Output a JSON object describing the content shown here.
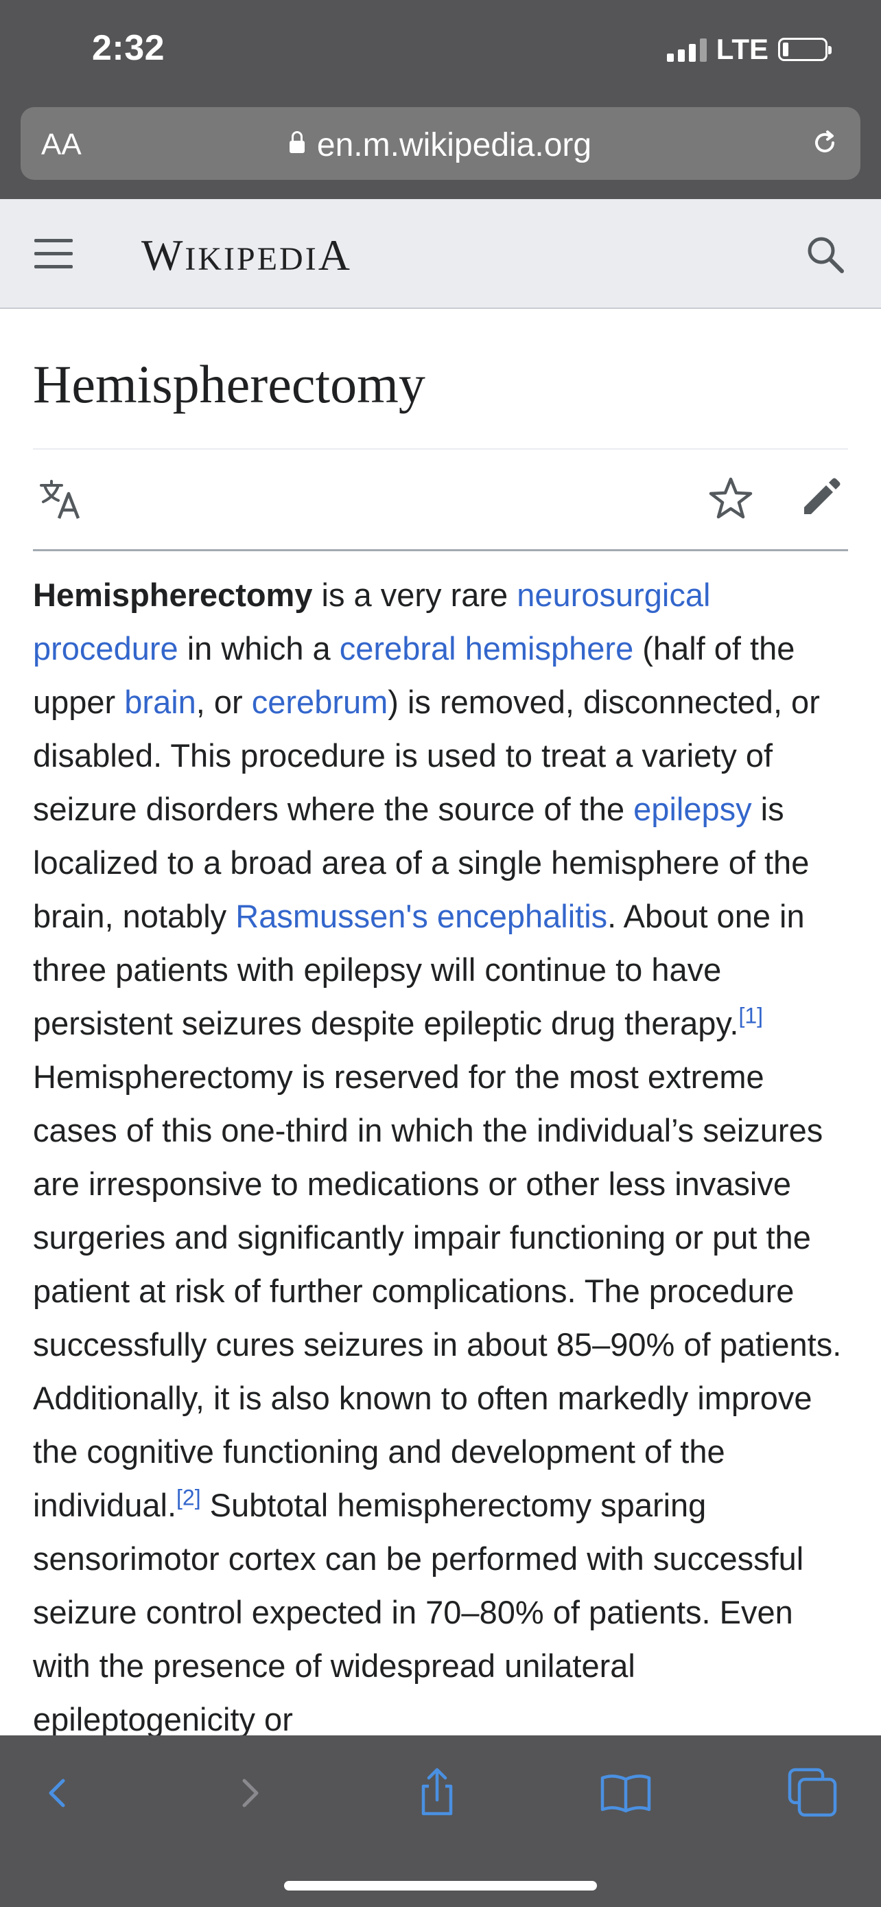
{
  "status_bar": {
    "time": "2:32",
    "network": "LTE"
  },
  "browser": {
    "text_size_label": "AA",
    "url": "en.m.wikipedia.org"
  },
  "wiki": {
    "wordmark_w": "W",
    "wordmark_ikipedi": "IKIPEDI",
    "wordmark_a": "A"
  },
  "article": {
    "title": "Hemispherectomy",
    "bold_term": "Hemispherectomy",
    "t1": " is a very rare ",
    "link_neurosurgical": "neurosurgical procedure",
    "t2": " in which a ",
    "link_cerebral_hemisphere": "cerebral hemisphere",
    "t3": " (half of the upper ",
    "link_brain": "brain",
    "t4": ", or ",
    "link_cerebrum": "cerebrum",
    "t5": ") is removed, disconnected, or disabled. This procedure is used to treat a variety of seizure disorders where the source of the ",
    "link_epilepsy": "epilepsy",
    "t6": " is localized to a broad area of a single hemisphere of the brain, notably ",
    "link_rasmussen": "Rasmussen's encephalitis",
    "t7": ". About one in three patients with epilepsy will continue to have persistent seizures despite epileptic drug therapy.",
    "ref1": "[1]",
    "t8": " Hemispherectomy is reserved for the most extreme cases of this one-third in which the individual’s seizures are irresponsive to medications or other less invasive surgeries and significantly impair functioning or put the patient at risk of further complications. The procedure successfully cures seizures in about 85–90% of patients. Additionally, it is also known to often markedly improve the cognitive functioning and development of the individual.",
    "ref2": "[2]",
    "t9": " Subtotal hemispherectomy sparing sensorimotor cortex can be performed with successful seizure control expected in 70–80% of patients. Even with the presence of widespread unilateral epileptogenicity or"
  },
  "colors": {
    "link": "#3366cc",
    "text": "#202122",
    "chrome": "#555557",
    "toolbar_icon": "#4a90e2"
  },
  "icons": [
    "hamburger-icon",
    "search-icon",
    "language-icon",
    "star-icon",
    "edit-icon",
    "back-icon",
    "forward-icon",
    "share-icon",
    "bookmarks-icon",
    "tabs-icon",
    "lock-icon",
    "reload-icon"
  ]
}
